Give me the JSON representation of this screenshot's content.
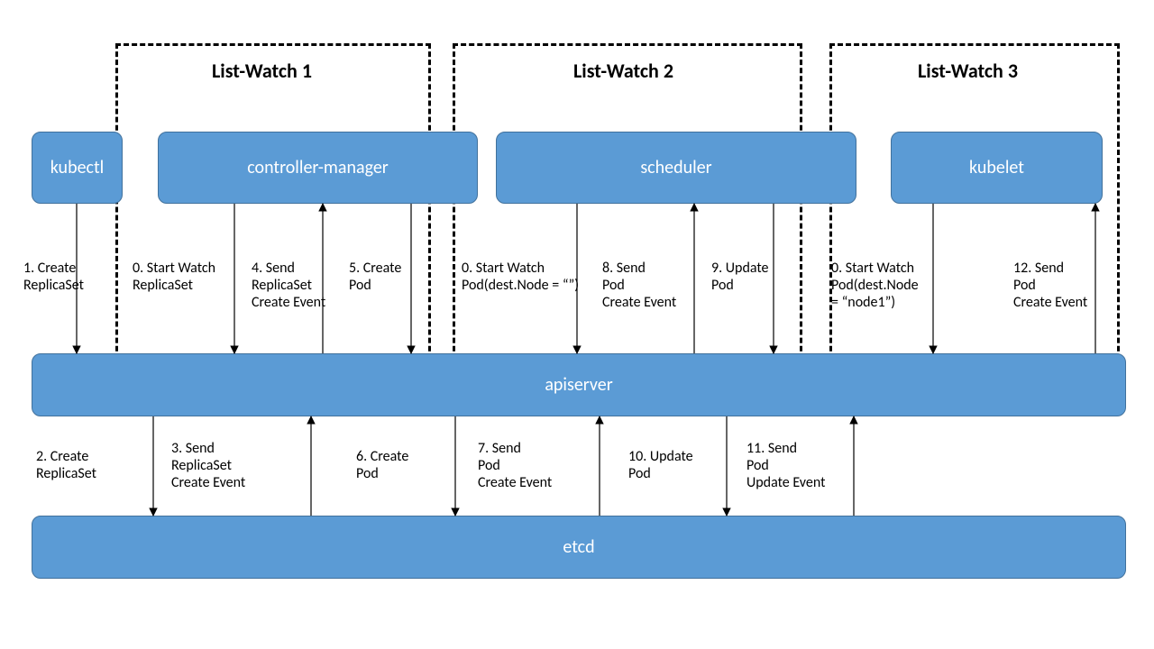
{
  "titles": {
    "t1": "List-Watch 1",
    "t2": "List-Watch 2",
    "t3": "List-Watch 3"
  },
  "boxes": {
    "kubectl": "kubectl",
    "controller_manager": "controller-manager",
    "scheduler": "scheduler",
    "kubelet": "kubelet",
    "apiserver": "apiserver",
    "etcd": "etcd"
  },
  "steps": {
    "s1": "1. Create\nReplicaSet",
    "s0a": "0. Start Watch\nReplicaSet",
    "s4": "4. Send\nReplicaSet\nCreate Event",
    "s5": "5. Create\nPod",
    "s0b": "0. Start Watch\nPod(dest.Node = “”)",
    "s8": "8. Send\nPod\nCreate Event",
    "s9": "9. Update\nPod",
    "s0c": "0. Start Watch\nPod(dest.Node\n= “node1”)",
    "s12": "12. Send\nPod\nCreate Event",
    "s2": "2. Create\nReplicaSet",
    "s3": "3. Send\nReplicaSet\nCreate Event",
    "s6": "6. Create\nPod",
    "s7": "7. Send\nPod\nCreate Event",
    "s10": "10. Update\nPod",
    "s11": "11. Send\nPod\nUpdate Event"
  }
}
